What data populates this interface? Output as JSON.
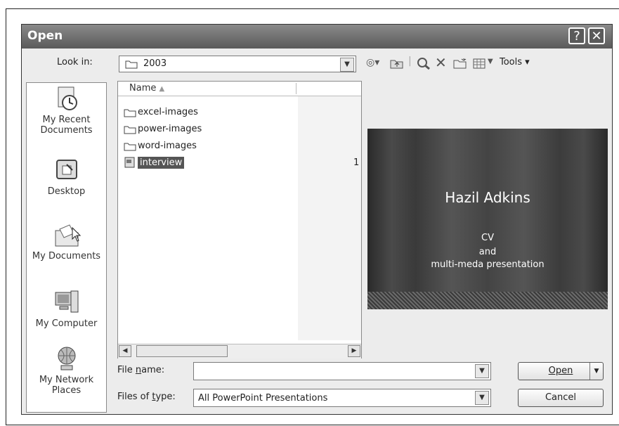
{
  "dialog": {
    "title": "Open",
    "help_glyph": "?",
    "close_glyph": "✕"
  },
  "look_in": {
    "label": "Look in:",
    "value": "2003"
  },
  "toolbar": {
    "tools_label": "Tools"
  },
  "places": [
    {
      "label": "My Recent Documents",
      "icon": "recent-documents-icon"
    },
    {
      "label": "Desktop",
      "icon": "desktop-icon"
    },
    {
      "label": "My Documents",
      "icon": "my-documents-icon"
    },
    {
      "label": "My Computer",
      "icon": "my-computer-icon"
    },
    {
      "label": "My Network Places",
      "icon": "network-places-icon"
    }
  ],
  "filelist": {
    "column_name": "Name",
    "items": [
      {
        "name": "excel-images",
        "type": "folder"
      },
      {
        "name": "power-images",
        "type": "folder"
      },
      {
        "name": "word-images",
        "type": "folder"
      },
      {
        "name": "interview",
        "type": "presentation",
        "selected": true
      }
    ],
    "truncated_column_text": "1"
  },
  "preview": {
    "title": "Hazil Adkins",
    "line1": "CV",
    "line2": "and",
    "line3": "multi-meda presentation"
  },
  "file_name": {
    "label": "File name:",
    "value": ""
  },
  "file_type": {
    "label": "Files of type:",
    "value": "All PowerPoint Presentations"
  },
  "buttons": {
    "open": "Open",
    "cancel": "Cancel"
  },
  "colors": {
    "titlebar": "#6e6e6e",
    "selection": "#555555"
  }
}
